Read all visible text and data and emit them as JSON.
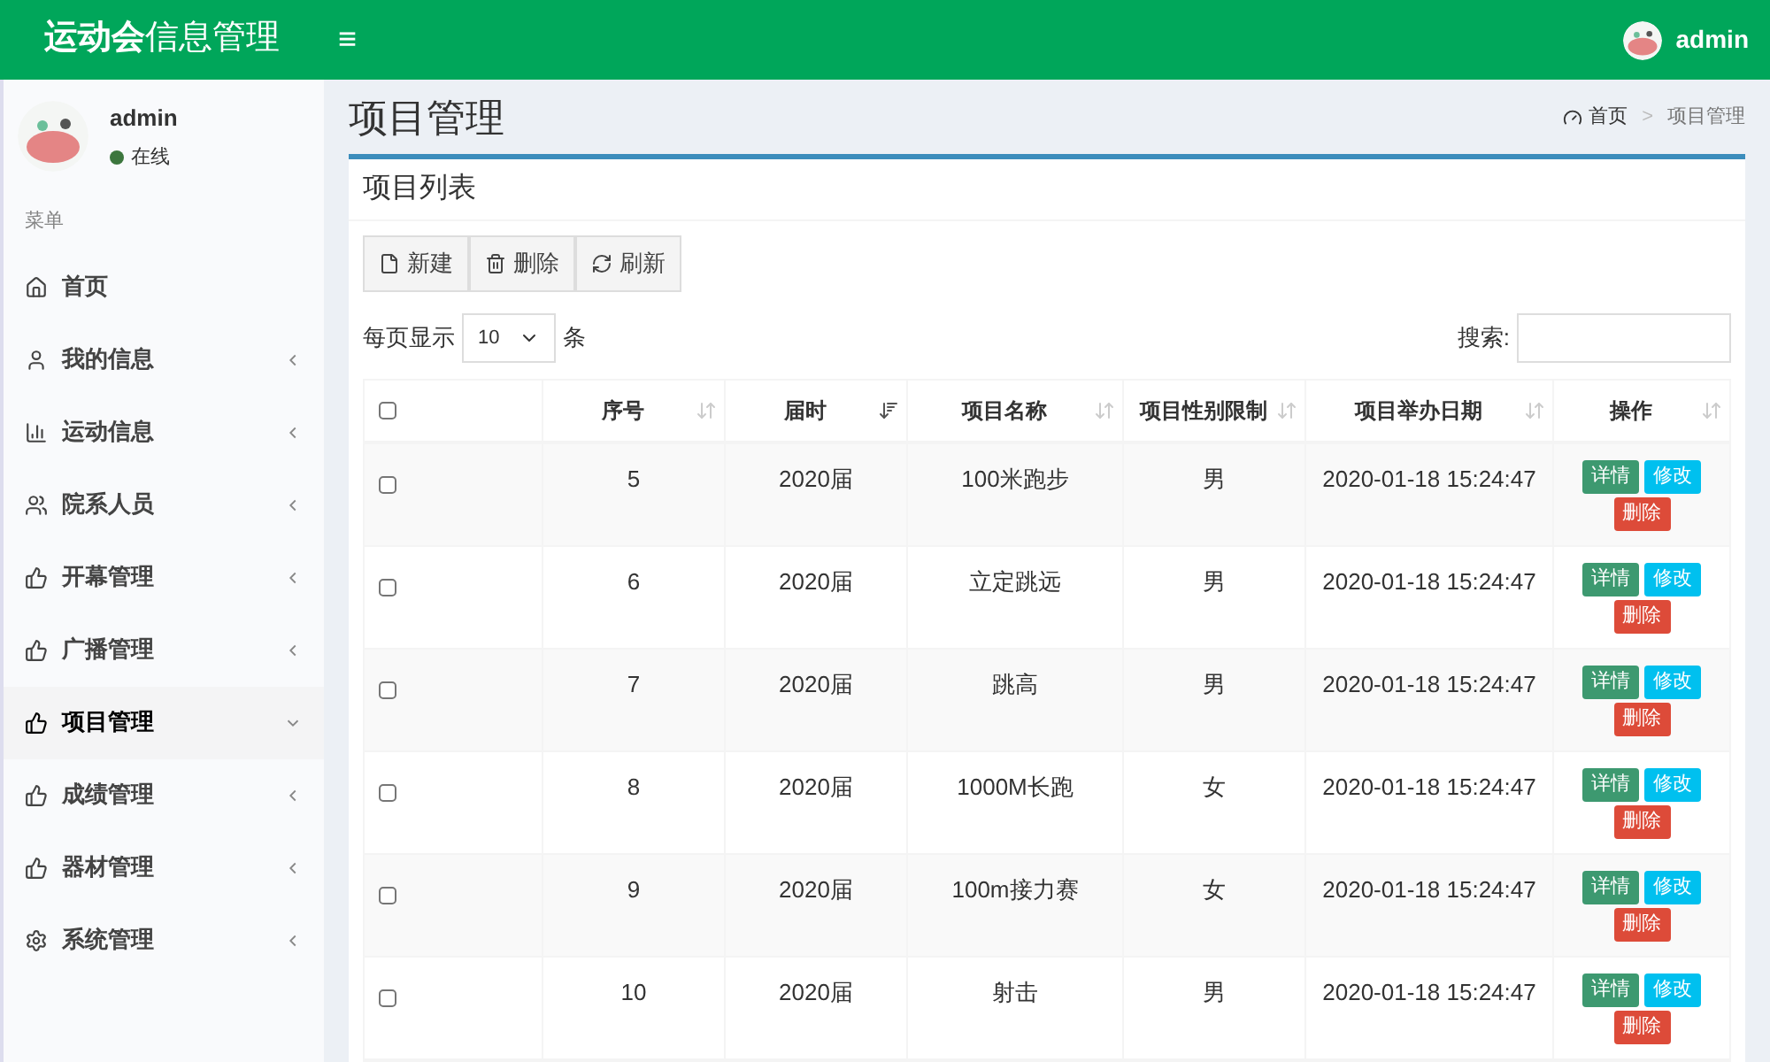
{
  "header": {
    "logo_bold": "运动会",
    "logo_rest": "信息管理",
    "menu_toggle": "≡",
    "user": "admin"
  },
  "sidebar": {
    "user": {
      "name": "admin",
      "status": "在线"
    },
    "section": "菜单",
    "items": [
      {
        "label": "首页",
        "selected": false
      },
      {
        "label": "我的信息",
        "selected": false,
        "expanded": false
      },
      {
        "label": "运动信息",
        "selected": false,
        "expanded": false
      },
      {
        "label": "院系人员",
        "selected": false,
        "expanded": false
      },
      {
        "label": "开幕管理",
        "selected": false,
        "expanded": false
      },
      {
        "label": "广播管理",
        "selected": false,
        "expanded": false
      },
      {
        "label": "项目管理",
        "selected": true,
        "expanded": true
      },
      {
        "label": "成绩管理",
        "selected": false,
        "expanded": false
      },
      {
        "label": "器材管理",
        "selected": false,
        "expanded": false
      },
      {
        "label": "系统管理",
        "selected": false,
        "expanded": false
      }
    ]
  },
  "page": {
    "title": "项目管理",
    "breadcrumb": [
      "首页",
      "项目管理"
    ],
    "breadcrumb_sep": ">"
  },
  "box": {
    "title": "项目列表",
    "toolbar": [
      "新建",
      "删除",
      "刷新"
    ],
    "length": {
      "prefix": "每页显示",
      "value": "10",
      "suffix": "条"
    },
    "search": {
      "label": "搜索:"
    }
  },
  "table": {
    "select_all": {
      "checked": false
    },
    "columns": [
      {
        "label": "序号",
        "sorted": false
      },
      {
        "label": "届时",
        "sorted": true
      },
      {
        "label": "项目名称",
        "sorted": false
      },
      {
        "label": "项目性别限制",
        "sorted": false
      },
      {
        "label": "项目举办日期",
        "sorted": false
      },
      {
        "label": "操作",
        "sorted": false
      }
    ],
    "rows": [
      {
        "checked": false,
        "cells": [
          "5",
          "2020届",
          "100米跑步",
          "男",
          "2020-01-18 15:24:47"
        ],
        "actions": [
          {
            "label": "详情",
            "color": "#3d9970"
          },
          {
            "label": "修改",
            "color": "#00c0ef"
          },
          {
            "label": "删除",
            "color": "#dd4b39"
          }
        ]
      },
      {
        "checked": false,
        "cells": [
          "6",
          "2020届",
          "立定跳远",
          "男",
          "2020-01-18 15:24:47"
        ],
        "actions": [
          {
            "label": "详情",
            "color": "#3d9970"
          },
          {
            "label": "修改",
            "color": "#00c0ef"
          },
          {
            "label": "删除",
            "color": "#dd4b39"
          }
        ]
      },
      {
        "checked": false,
        "cells": [
          "7",
          "2020届",
          "跳高",
          "男",
          "2020-01-18 15:24:47"
        ],
        "actions": [
          {
            "label": "详情",
            "color": "#3d9970"
          },
          {
            "label": "修改",
            "color": "#00c0ef"
          },
          {
            "label": "删除",
            "color": "#dd4b39"
          }
        ]
      },
      {
        "checked": false,
        "cells": [
          "8",
          "2020届",
          "1000M长跑",
          "女",
          "2020-01-18 15:24:47"
        ],
        "actions": [
          {
            "label": "详情",
            "color": "#3d9970"
          },
          {
            "label": "修改",
            "color": "#00c0ef"
          },
          {
            "label": "删除",
            "color": "#dd4b39"
          }
        ]
      },
      {
        "checked": false,
        "cells": [
          "9",
          "2020届",
          "100m接力赛",
          "女",
          "2020-01-18 15:24:47"
        ],
        "actions": [
          {
            "label": "详情",
            "color": "#3d9970"
          },
          {
            "label": "修改",
            "color": "#00c0ef"
          },
          {
            "label": "删除",
            "color": "#dd4b39"
          }
        ]
      },
      {
        "checked": false,
        "cells": [
          "10",
          "2020届",
          "射击",
          "男",
          "2020-01-18 15:24:47"
        ],
        "actions": [
          {
            "label": "详情",
            "color": "#3d9970"
          },
          {
            "label": "修改",
            "color": "#00c0ef"
          },
          {
            "label": "删除",
            "color": "#dd4b39"
          }
        ]
      }
    ]
  }
}
